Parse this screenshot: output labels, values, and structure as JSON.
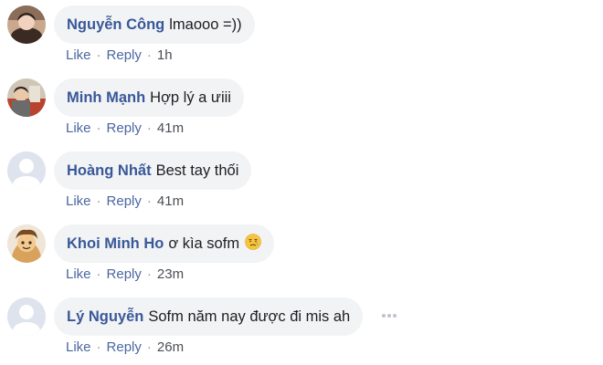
{
  "comments": [
    {
      "author": "Nguyễn Công",
      "text": "lmaooo =))",
      "like": "Like",
      "reply": "Reply",
      "time": "1h"
    },
    {
      "author": "Minh Mạnh",
      "text": "Hợp lý a ưiii",
      "like": "Like",
      "reply": "Reply",
      "time": "41m"
    },
    {
      "author": "Hoàng Nhất",
      "text": "Best tay thối",
      "like": "Like",
      "reply": "Reply",
      "time": "41m"
    },
    {
      "author": "Khoi Minh Ho",
      "text": "ơ kìa sofm",
      "like": "Like",
      "reply": "Reply",
      "time": "23m",
      "emoji": "disappointed-relieved-face"
    },
    {
      "author": "Lý Nguyễn",
      "text": "Sofm năm nay được đi mis ah",
      "like": "Like",
      "reply": "Reply",
      "time": "26m"
    }
  ],
  "dot_separator": "·",
  "colors": {
    "author": "#385898",
    "action_link": "#4b67a1",
    "bubble_bg": "#f2f3f5",
    "text": "#1c1e21"
  },
  "icons": {
    "more": "more-options-icon",
    "default_avatar": "default-avatar-silhouette"
  }
}
